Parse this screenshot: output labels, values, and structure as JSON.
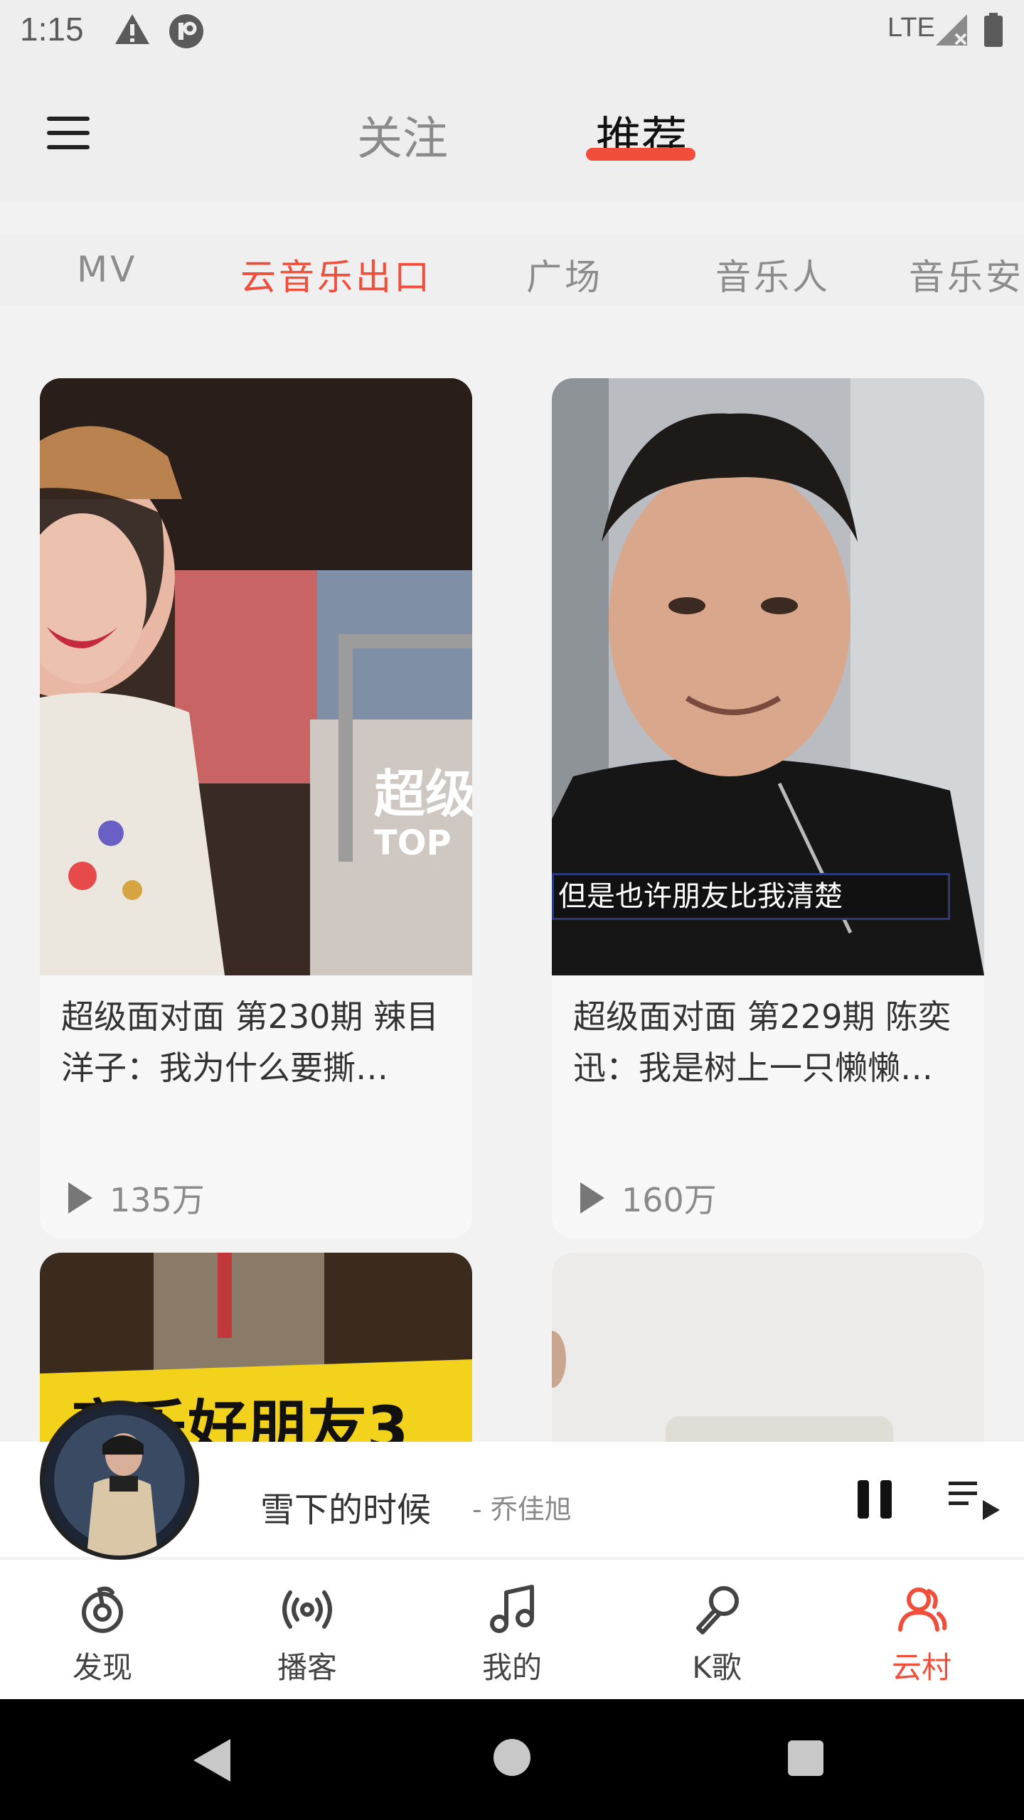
{
  "status": {
    "time": "1:15",
    "network": "LTE"
  },
  "header": {
    "tabs": [
      "关注",
      "推荐"
    ],
    "active_tab": "推荐"
  },
  "sub_tabs": {
    "items": [
      "MV",
      "云音乐出口",
      "广场",
      "音乐人",
      "音乐安"
    ],
    "active": "云音乐出口"
  },
  "cards": [
    {
      "title": "超级面对面 第230期  辣目洋子：我为什么要撕…",
      "plays": "135万",
      "thumb_caption": ""
    },
    {
      "title": "超级面对面 第229期 陈奕迅：我是树上一只懒懒…",
      "plays": "160万",
      "thumb_caption": "但是也许朋友比我清楚"
    },
    {
      "title": "",
      "plays": "",
      "thumb_caption": "音乐好朋友3"
    },
    {
      "title": "",
      "plays": "",
      "thumb_caption": ""
    }
  ],
  "player": {
    "song": "雪下的时候",
    "artist": "- 乔佳旭"
  },
  "bottom_nav": [
    {
      "label": "发现",
      "icon": "netease-logo-icon"
    },
    {
      "label": "播客",
      "icon": "radio-broadcast-icon"
    },
    {
      "label": "我的",
      "icon": "music-note-icon"
    },
    {
      "label": "K歌",
      "icon": "microphone-icon"
    },
    {
      "label": "云村",
      "icon": "people-icon"
    }
  ],
  "colors": {
    "accent": "#f04d3a",
    "background": "#f2f2f2"
  }
}
